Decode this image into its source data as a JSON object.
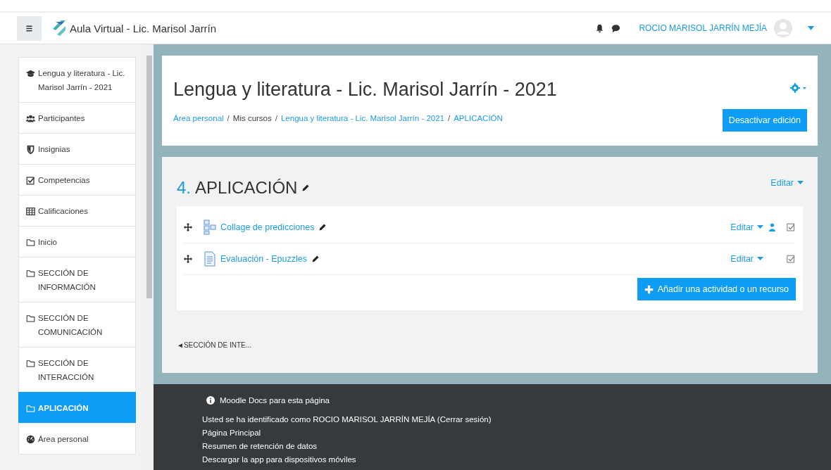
{
  "navbar": {
    "site_name": "Aula Virtual - Lic. Marisol Jarrín",
    "user_name": "ROCIO MARISOL JARRÍN MEJÍA"
  },
  "sidebar": {
    "items": [
      {
        "kind": "course",
        "label": "Lengua y literatura - Lic. Marisol Jarrín - 2021",
        "selected": false
      },
      {
        "kind": "participants",
        "label": "Participantes",
        "selected": false
      },
      {
        "kind": "badges",
        "label": "Insignias",
        "selected": false
      },
      {
        "kind": "competencies",
        "label": "Competencias",
        "selected": false
      },
      {
        "kind": "grades",
        "label": "Calificaciones",
        "selected": false
      },
      {
        "kind": "section",
        "label": "Inicio",
        "selected": false
      },
      {
        "kind": "section",
        "label": "SECCIÓN DE INFORMACIÓN",
        "selected": false
      },
      {
        "kind": "section",
        "label": "SECCIÓN DE COMUNICACIÓN",
        "selected": false
      },
      {
        "kind": "section",
        "label": "SECCIÓN DE INTERACCIÓN",
        "selected": false
      },
      {
        "kind": "section",
        "label": "APLICACIÓN",
        "selected": true
      },
      {
        "kind": "dashboard",
        "label": "Área personal",
        "selected": false
      }
    ]
  },
  "header": {
    "title": "Lengua y literatura - Lic. Marisol Jarrín - 2021",
    "breadcrumb_separator": "/",
    "breadcrumb": [
      {
        "label": "Área personal",
        "link": true
      },
      {
        "label": "Mis cursos",
        "link": false
      },
      {
        "label": "Lengua y literatura - Lic. Marisol Jarrín - 2021",
        "link": true
      },
      {
        "label": "APLICACIÓN",
        "link": true
      }
    ],
    "edit_button": "Desactivar edición"
  },
  "section": {
    "number": "4.",
    "title": "APLICACIÓN",
    "edit_menu": "Editar",
    "activities": [
      {
        "kind": "folder",
        "title": "Collage de predicciones",
        "edit_menu": "Editar",
        "restricted": true
      },
      {
        "kind": "page",
        "title": "Evaluación - Epuzzles",
        "edit_menu": "Editar",
        "restricted": false
      }
    ],
    "add_button": "Añadir una actividad o un recurso",
    "previous_section": "◄SECCIÓN DE INTE..."
  },
  "footer": {
    "docs_link": "Moodle Docs para esta página",
    "login_prefix": "Usted se ha identificado como ",
    "login_user": "ROCIO MARISOL JARRÍN MEJÍA",
    "logout": "(Cerrar sesión)",
    "links": [
      "Página Principal",
      "Resumen de retención de datos",
      "Descargar la app para dispositivos móviles"
    ]
  }
}
